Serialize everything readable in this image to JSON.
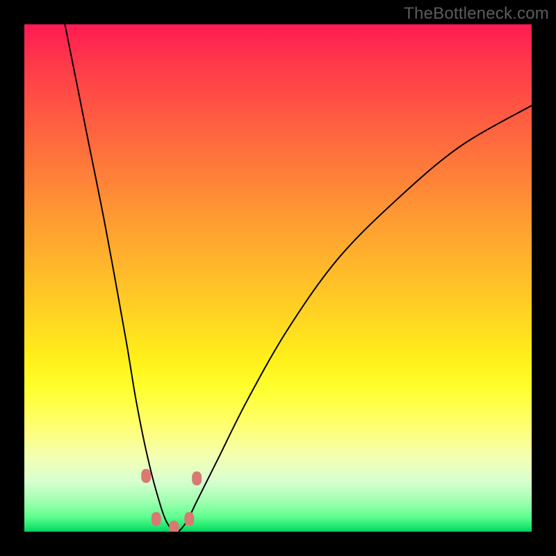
{
  "watermark": "TheBottleneck.com",
  "colors": {
    "frame": "#000000",
    "top": "#ff1a52",
    "bottom": "#00d060",
    "curve": "#000000",
    "marker": "#d87a72"
  },
  "chart_data": {
    "type": "line",
    "title": "",
    "xlabel": "",
    "ylabel": "",
    "xlim": [
      0,
      100
    ],
    "ylim": [
      0,
      100
    ],
    "note": "V-shaped bottleneck curve; values are approximate pixel-space readings normalized to 0-100. Minimum near x≈27-31 at y≈0; right branch rises but peaks below left-branch start.",
    "series": [
      {
        "name": "bottleneck-curve",
        "x": [
          8,
          12,
          16,
          20,
          22,
          24,
          26,
          28,
          30,
          32,
          34,
          38,
          44,
          52,
          62,
          74,
          86,
          100
        ],
        "y": [
          100,
          80,
          60,
          38,
          26,
          16,
          8,
          2,
          0,
          2,
          6,
          14,
          26,
          40,
          54,
          66,
          76,
          84
        ]
      }
    ],
    "markers": [
      {
        "x": 24.0,
        "y": 11.0
      },
      {
        "x": 26.0,
        "y": 2.5
      },
      {
        "x": 29.5,
        "y": 0.8
      },
      {
        "x": 32.5,
        "y": 2.5
      },
      {
        "x": 34.0,
        "y": 10.5
      }
    ]
  }
}
